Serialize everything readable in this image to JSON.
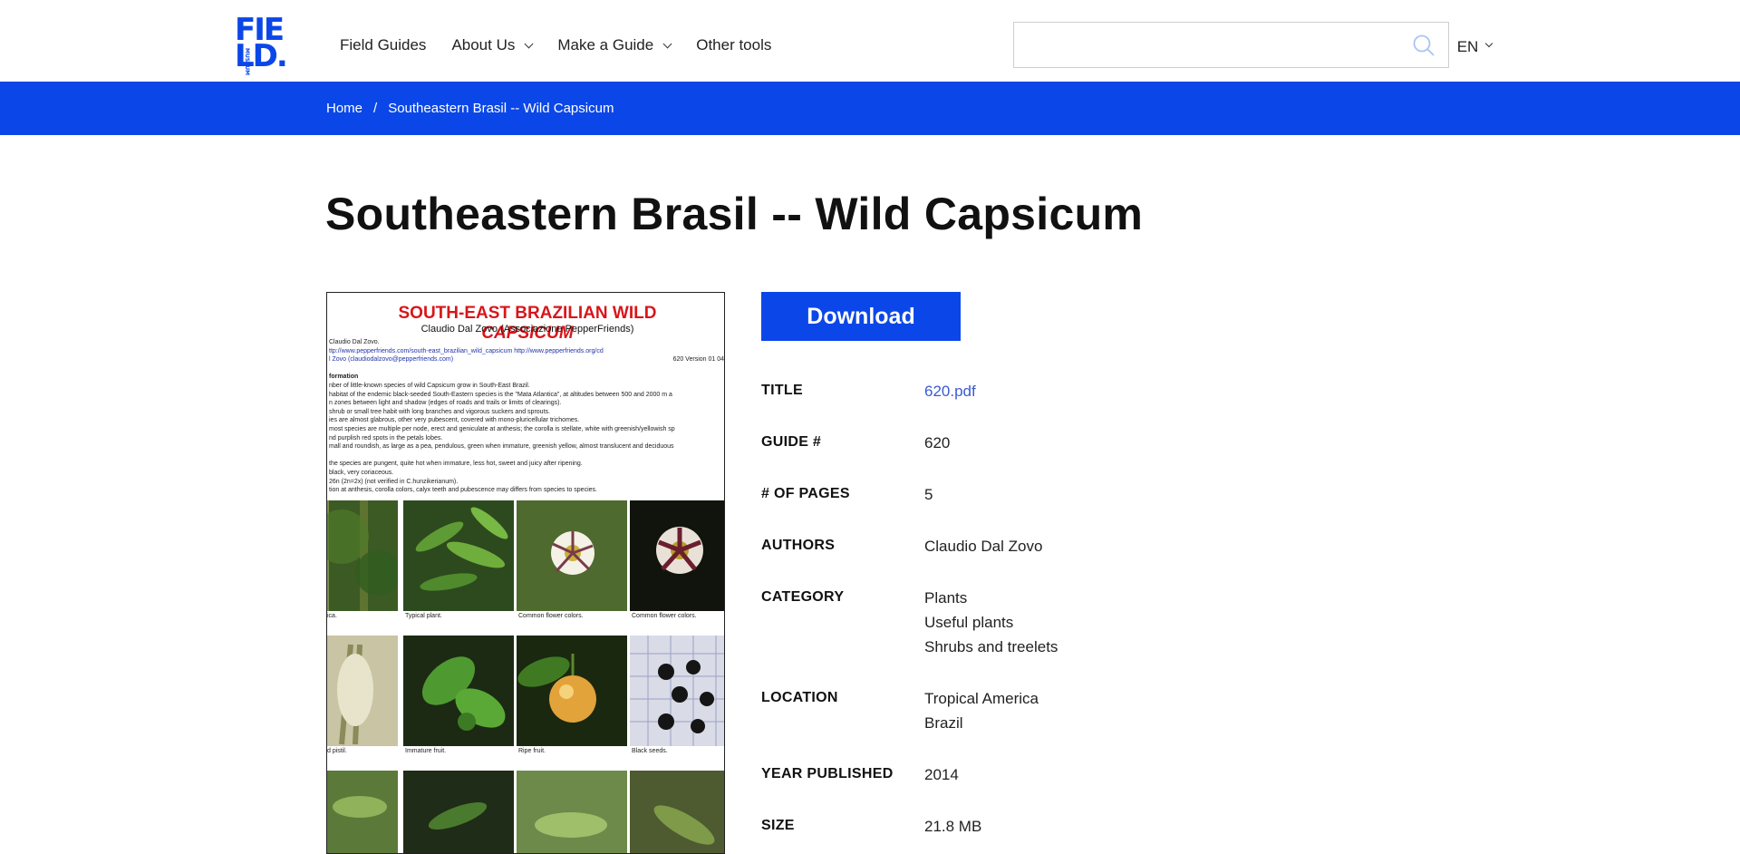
{
  "header": {
    "logo_text_1": "FIE",
    "logo_text_2": "LD.",
    "logo_vertical": "MUSEUM",
    "nav": [
      {
        "label": "Field Guides",
        "has_dropdown": false
      },
      {
        "label": "About Us",
        "has_dropdown": true
      },
      {
        "label": "Make a Guide",
        "has_dropdown": true
      },
      {
        "label": "Other tools",
        "has_dropdown": false
      }
    ],
    "search": {
      "placeholder": "",
      "value": ""
    },
    "language": "EN"
  },
  "breadcrumb": {
    "home": "Home",
    "separator": "/",
    "current": "Southeastern Brasil -- Wild Capsicum"
  },
  "page_title": "Southeastern Brasil -- Wild Capsicum",
  "preview": {
    "title_main": "SOUTH-EAST BRAZILIAN WILD ",
    "title_italic": "CAPSICUM",
    "subtitle": "Claudio Dal Zovo (Associazione PepperFriends)",
    "lines": [
      "Claudio Dal Zovo.",
      "ttp://www.pepperfriends.com/south-east_brazilian_wild_capsicum   http://www.pepperfriends.org/cd",
      "l Zovo (claudiodalzovo@pepperfriends.com)",
      "620  Version 01 04",
      "",
      "formation",
      "nber of little-known species of wild Capsicum grow in South-East Brazil.",
      "habitat of the endemic black-seeded South-Eastern species is the \"Mata Atlantica\", at altitudes between 500 and 2000 m a",
      "n zones between light and shadow (edges of roads and trails or limits of clearings).",
      "shrub or small tree habit with long branches and vigorous suckers and sprouts.",
      "ies are almost glabrous, other very pubescent, covered with mono-pluricellular trichomes.",
      "most species are multiple per node, erect and geniculate at anthesis; the corolla is stellate, white with greenish/yellowish sp",
      "nd purplish red spots in the petals lobes.",
      "mall and roundish, as large as a pea, pendulous, green when immature, greenish yellow, almost translucent and deciduous",
      "",
      "the species are pungent, quite hot when immature, less hot, sweet and juicy after ripening.",
      "black, very coriaceous.",
      "26n (2n=2x) (not verified in C.hunzikerianum).",
      "tion at anthesis, corolla colors, calyx teeth and pubescence may differs from species to species."
    ],
    "captions": [
      "ica.",
      "Typical plant.",
      "Common flower colors.",
      "Common flower colors.",
      "d pistil.",
      "Immature fruit.",
      "Ripe fruit.",
      "Black seeds."
    ]
  },
  "download_label": "Download",
  "meta": [
    {
      "label": "TITLE",
      "values": [
        "620.pdf"
      ],
      "is_link": true
    },
    {
      "label": "GUIDE #",
      "values": [
        "620"
      ]
    },
    {
      "label": "# OF PAGES",
      "values": [
        "5"
      ]
    },
    {
      "label": "AUTHORS",
      "values": [
        "Claudio Dal Zovo"
      ]
    },
    {
      "label": "CATEGORY",
      "values": [
        "Plants",
        "Useful plants",
        "Shrubs and treelets"
      ]
    },
    {
      "label": "LOCATION",
      "values": [
        "Tropical America",
        "Brazil"
      ]
    },
    {
      "label": "YEAR PUBLISHED",
      "values": [
        "2014"
      ]
    },
    {
      "label": "SIZE",
      "values": [
        "21.8 MB"
      ]
    }
  ],
  "colors": {
    "brand_blue": "#0b47e8",
    "link": "#3a5bd0",
    "preview_title_red": "#d8161b"
  }
}
